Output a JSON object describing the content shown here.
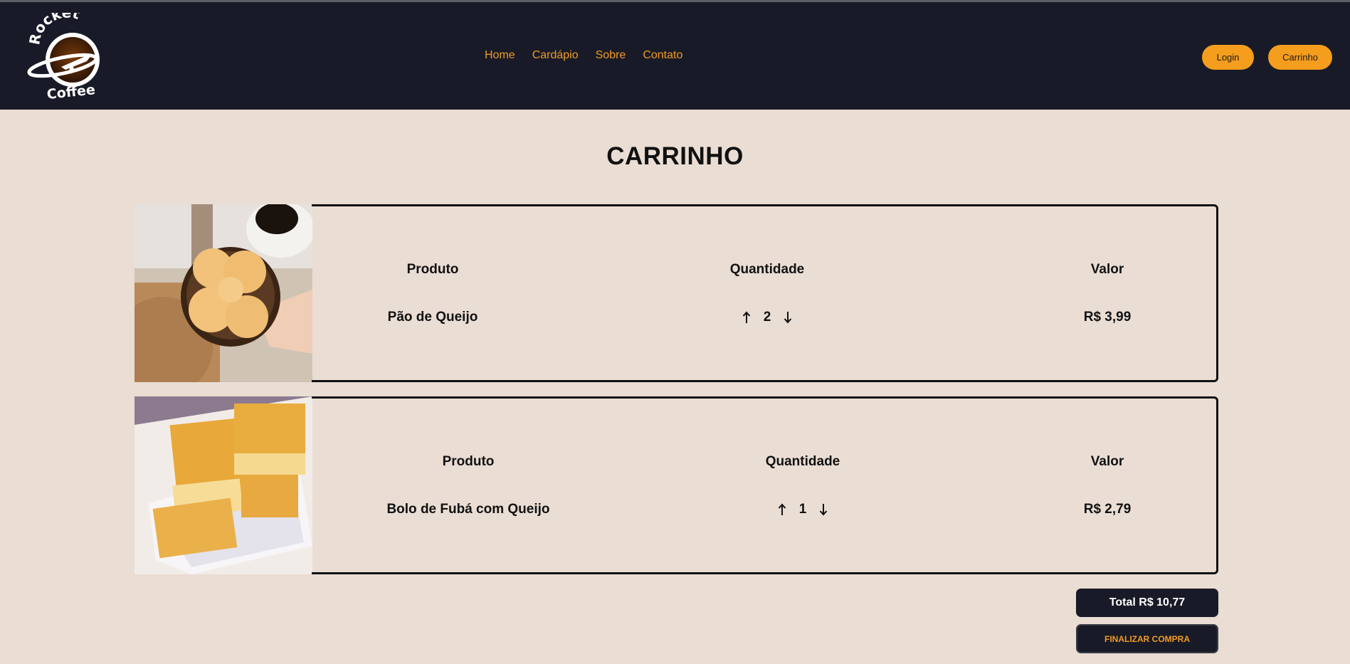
{
  "brand": {
    "line1": "Rocket",
    "line2": "Coffee"
  },
  "nav": [
    {
      "label": "Home"
    },
    {
      "label": "Cardápio"
    },
    {
      "label": "Sobre"
    },
    {
      "label": "Contato"
    }
  ],
  "header_buttons": {
    "login": "Login",
    "cart": "Carrinho"
  },
  "page_title": "CARRINHO",
  "items": [
    {
      "headers": {
        "product": "Produto",
        "quantity": "Quantidade",
        "value": "Valor"
      },
      "product": "Pão de Queijo",
      "quantity": "2",
      "price": "R$ 3,99",
      "image": "pao-de-queijo-photo"
    },
    {
      "headers": {
        "product": "Produto",
        "quantity": "Quantidade",
        "value": "Valor"
      },
      "product": "Bolo de Fubá com Queijo",
      "quantity": "1",
      "price": "R$ 2,79",
      "image": "bolo-de-fuba-photo"
    }
  ],
  "total": "Total R$ 10,77",
  "finish_button": "FINALIZAR COMPRA",
  "colors": {
    "header_bg": "#181b27",
    "accent": "#f59d1c",
    "nav_text": "#f29a24",
    "page_bg": "#eaddd4"
  },
  "icons": {
    "increase": "arrow-up-icon",
    "decrease": "arrow-down-icon"
  }
}
